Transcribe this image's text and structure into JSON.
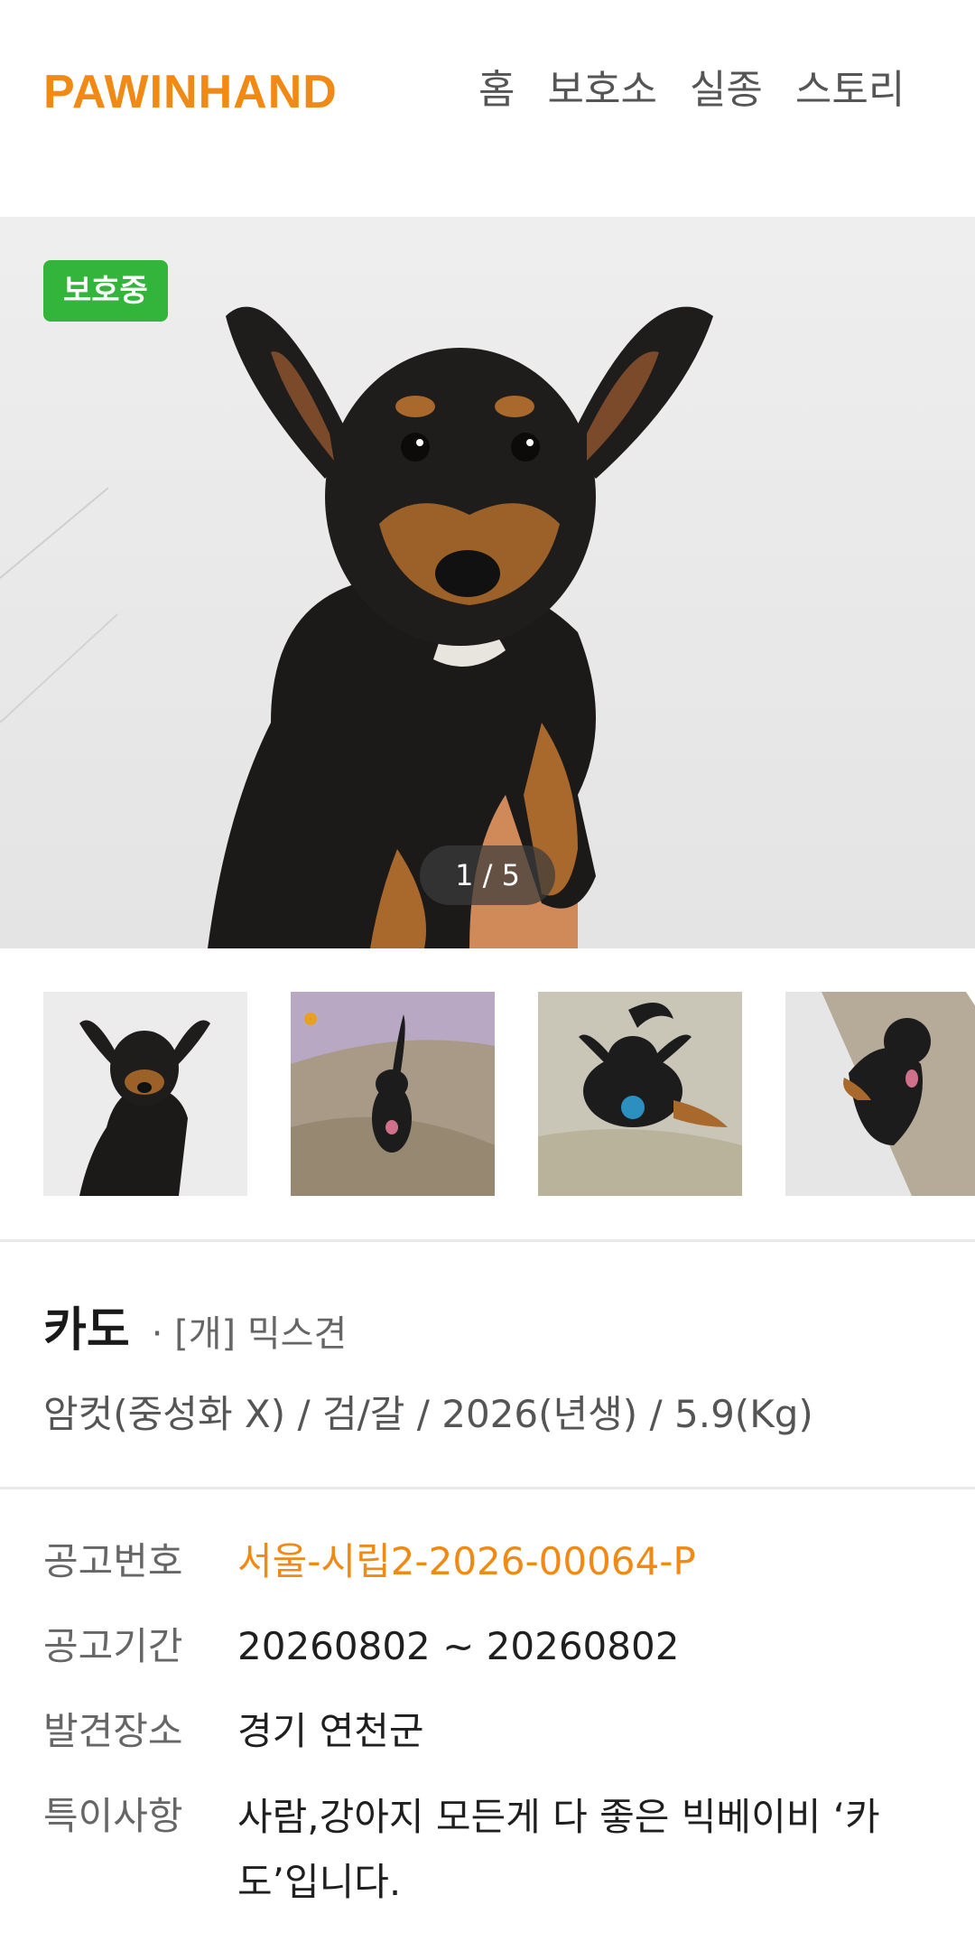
{
  "header": {
    "logo": "PAWINHAND",
    "nav": [
      "홈",
      "보호소",
      "실종",
      "스토리"
    ]
  },
  "hero": {
    "status": "보호중",
    "counter": "1 / 5"
  },
  "thumbnails": [
    "dog-photo-1",
    "dog-photo-2",
    "dog-photo-3",
    "dog-photo-4"
  ],
  "pet": {
    "name": "카도",
    "breed": "· [개] 믹스견",
    "summary": "암컷(중성화 X) / 검/갈 / 2026(년생) / 5.9(Kg)"
  },
  "info": {
    "notice_no_label": "공고번호",
    "notice_no": "서울-시립2-2026-00064-P",
    "period_label": "공고기간",
    "period": "20260802 ~ 20260802",
    "place_label": "발견장소",
    "place": "경기 연천군",
    "notes_label": "특이사항",
    "notes": "사람,강아지 모든게 다 좋은 빅베이비 ‘카도’입니다."
  },
  "colors": {
    "brand": "#f08a14",
    "status_green": "#33b53c"
  }
}
